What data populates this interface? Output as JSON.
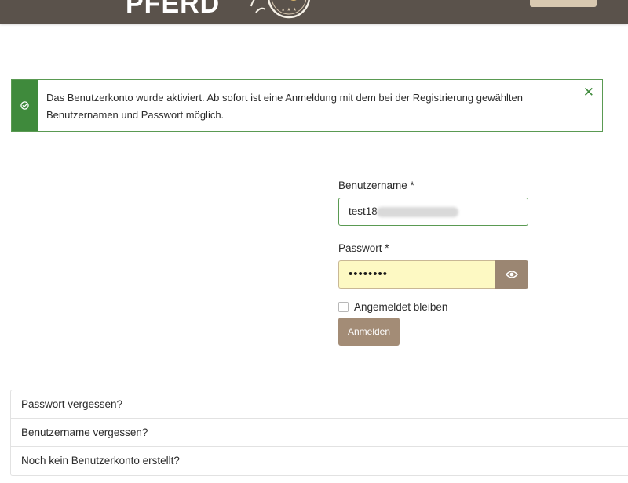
{
  "header": {
    "logo_text": "PFERD"
  },
  "alert": {
    "message": "Das Benutzerkonto wurde aktiviert. Ab sofort ist eine Anmeldung mit dem bei der Registrierung gewählten Benutzernamen und Passwort möglich.",
    "close_label": "✕",
    "icon": "check-circle-icon",
    "color": "#3f8a3c"
  },
  "login": {
    "username_label": "Benutzername *",
    "username_value": "test18",
    "password_label": "Passwort *",
    "password_value": "••••••••",
    "password_toggle_icon": "eye-icon",
    "remember_label": "Angemeldet bleiben",
    "remember_checked": false,
    "submit_label": "Anmelden"
  },
  "links": [
    {
      "label": "Passwort vergessen?"
    },
    {
      "label": "Benutzername vergessen?"
    },
    {
      "label": "Noch kein Benutzerkonto erstellt?"
    }
  ],
  "colors": {
    "header_bg": "#5a524b",
    "accent": "#a38c76",
    "success": "#3f8a3c"
  }
}
